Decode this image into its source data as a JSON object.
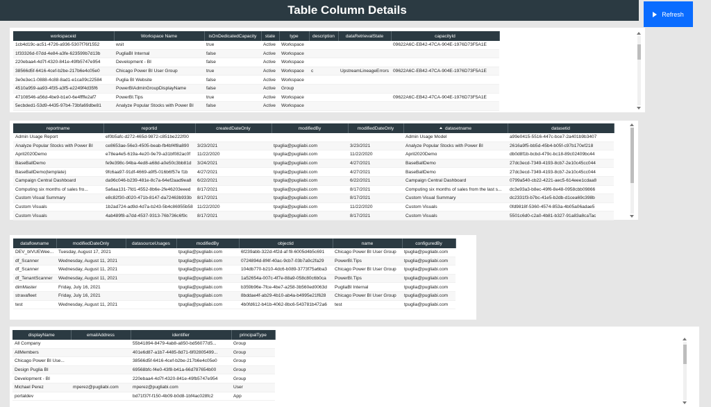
{
  "header": {
    "title": "Table Column Details",
    "refresh_label": "Refresh"
  },
  "workspaces": {
    "columns": [
      "workspaceid",
      "Workspace Name",
      "isOnDedicatedCapacity",
      "state",
      "type",
      "description",
      "dataRetrievalState",
      "capacityId"
    ],
    "rows": [
      [
        "1cb4d19c-ac51-4726-a936-5307f76f1552",
        "wsit",
        "true",
        "Active",
        "Workspace",
        "",
        "",
        "09622A6C-EB42-47CA-904E-1976D73F5A1E"
      ],
      [
        "1f33326d-07dd-4e84-a3fe-623599b7d13b",
        "PugliaBI Internal",
        "false",
        "Active",
        "Workspace",
        "",
        "",
        ""
      ],
      [
        "220ebaa4-4d7f-4320-841e-49fb5747e954",
        "Development - BI",
        "false",
        "Active",
        "Workspace",
        "",
        "",
        ""
      ],
      [
        "38566d5f-6416-4cef-b2be-217b6e4c05e0",
        "Chicago Power BI User Group",
        "true",
        "Active",
        "Workspace",
        "c",
        "UpstreamLineageErrors",
        "09622A6C-EB42-47CA-904E-1976D73F5A1E"
      ],
      [
        "3e0e3ec1-0888-4c88-8ad1-e1ca09c22584",
        "Puglia BI Website",
        "false",
        "Active",
        "Workspace",
        "",
        "",
        ""
      ],
      [
        "4510a959-aa93-4f35-a3f5-e2249f4d35f6",
        "PowerBIAdminGroupDisplayName",
        "false",
        "Active",
        "Group",
        "",
        "",
        ""
      ],
      [
        "47108546-a56d-4be9-b1e0-6e4ffffe2af7",
        "PowerBI.Tips",
        "true",
        "Active",
        "Workspace",
        "",
        "",
        "09622A6C-EB42-47CA-904E-1976D73F5A1E"
      ],
      [
        "5ecbded1-53d9-4435-97b4-73bfa69dbe81",
        "Analyze Popular Stocks with Power BI",
        "false",
        "Active",
        "Workspace",
        "",
        "",
        ""
      ]
    ]
  },
  "reports": {
    "columns": [
      "reportname",
      "reportid",
      "createdDateOnly",
      "modifiedBy",
      "modifiedDateOnly",
      "datasetname",
      "datasetid"
    ],
    "rows": [
      [
        "Admin Usage Report",
        "ef0b5afc-d272-465d-9872-c851be222f00",
        "",
        "",
        "",
        "Admin Usage Model",
        "a99e0415-5516-447c-bce7-2a401b9b3407"
      ],
      [
        "Analyze Popular Stocks with Power BI",
        "ce8653ae-56e3-4505-beab-fb4bf4f8a890",
        "3/23/2021",
        "tpuglia@pugliabi.com",
        "3/23/2021",
        "Analyze Popular Stocks with Power BI",
        "2616a9f5-bb5d-45b4-b05f-c97b170ef218"
      ],
      [
        "April2020Demo",
        "e78ea4e5-619a-4e20-9e79-a31bf082ac0f",
        "11/22/2020",
        "tpuglia@pugliabi.com",
        "11/22/2020",
        "April2020Demo",
        "db0d8f1b-bcbd-479c-bc18-89c02409bc44"
      ],
      [
        "BaseBallDemo",
        "fe9e398c-94ba-4ed8-a68d-a0e50c3bb81d",
        "3/24/2021",
        "tpuglia@pugliabi.com",
        "4/27/2021",
        "BaseBallDemo",
        "27dc3ecd-7349-4193-8cb7-2e10c45cc044"
      ],
      [
        "BaseBallDemo(template)",
        "9fc6aa97-91df-4669-a9f5-016b6f57e f1b",
        "4/27/2021",
        "tpuglia@pugliabi.com",
        "4/27/2021",
        "BaseBallDemo",
        "27dc3ecd-7349-4193-8cb7-2e10c45cc044"
      ],
      [
        "Campaign Central Dashboard",
        "da96c046-b239-481e-8c7a-64ef2aad9ea8",
        "6/22/2021",
        "tpuglia@pugliabi.com",
        "6/22/2021",
        "Campaign Central Dashboard",
        "0799a540-cb22-4221-aec5-614eee1cdaa8"
      ],
      [
        "Computing six months of sales fro...",
        "5a6aa131-7fd1-4552-8b6e-2fe46203eeed",
        "8/17/2021",
        "tpuglia@pugliabi.com",
        "8/17/2021",
        "Computing six months of sales from the last s...",
        "dc3e93a3-b8ec-49f6-8e48-0958cbb09866"
      ],
      [
        "Custom Visual Summary",
        "e8c82f30-d020-471b-8147-da72463b933b",
        "8/17/2021",
        "tpuglia@pugliabi.com",
        "8/17/2021",
        "Custom Visual Summary",
        "dc2331f3-b7bc-41e5-b2db-d1cea69c398b"
      ],
      [
        "Custom Visuals",
        "1b2ad724-ad9d-4d7a-b243-5b4c86955b58",
        "11/22/2020",
        "tpuglia@pugliabi.com",
        "11/22/2020",
        "Custom Visuals",
        "0fd9818f-5360-4574-853a-4b05a06adae5"
      ],
      [
        "Custom Visuals",
        "4ab489f8-a7dd-4537-9313-76b736c6f9c",
        "8/17/2021",
        "tpuglia@pugliabi.com",
        "8/17/2021",
        "Custom Visuals",
        "5501c6d0-c2a0-4b81-b327-91a83a8caTac"
      ]
    ]
  },
  "dataflows": {
    "columns": [
      "dataflowname",
      "modifiedDateOnly",
      "datasourceUsages",
      "modifiedBy",
      "objectid",
      "name",
      "configuredBy"
    ],
    "rows": [
      [
        "DEV_bIVUEWee...",
        "Tuesday, August 17, 2021",
        "",
        "tpuglia@pugliabi.com",
        "6f239abb-322d-4f2d-af f8-6005d4b5c691",
        "Chicago Power BI User Group",
        "tpuglia@pugliabi.com"
      ],
      [
        "df_Scanner",
        "Wednesday, August 11, 2021",
        "",
        "tpuglia@pugliabi.com",
        "0724894d-8f4f-40ac-9cb7-03b7a9c2fa29",
        "PowerBI.Tips",
        "tpuglia@pugliabi.com"
      ],
      [
        "df_Scanner",
        "Wednesday, August 11, 2021",
        "",
        "tpuglia@pugliabi.com",
        "104db770-b210-4dc6-b089-3773f75a6ba3",
        "Chicago Power BI User Group",
        "tpuglia@pugliabi.com"
      ],
      [
        "df_TenantScanner",
        "Wednesday, August 11, 2021",
        "",
        "tpuglia@pugliabi.com",
        "1a52654a-007c-4f7e-88a9-058c80c6b0ca",
        "PowerBI.Tips",
        "tpuglia@pugliabi.com"
      ],
      [
        "dimMaster",
        "Friday, July 16, 2021",
        "",
        "tpuglia@pugliabi.com",
        "b359b96e-7fce-4be7-a258-3b560ed0063d",
        "PugliaBI Internal",
        "tpuglia@pugliabi.com"
      ],
      [
        "stravafleet",
        "Friday, July 16, 2021",
        "",
        "tpuglia@pugliabi.com",
        "8bddae4f-ab29-4b10-ab4a-b4995e21f628",
        "Chicago Power BI User Group",
        "tpuglia@pugliabi.com"
      ],
      [
        "test",
        "Wednesday, August 11, 2021",
        "",
        "tpuglia@pugliabi.com",
        "4b0fd612-b41b-4062-8bc6-543781b472a6",
        "test",
        "tpuglia@pugliabi.com"
      ]
    ]
  },
  "principals": {
    "columns": [
      "displayName",
      "emailAddress",
      "identifier",
      "principalType"
    ],
    "rows": [
      [
        "All Company",
        "",
        "55b41894-8479-4ab8-a850-bd56077d5...",
        "Group"
      ],
      [
        "AllMembers",
        "",
        "401e6d87-a1b7-4485-8d71-6f02805499...",
        "Group"
      ],
      [
        "Chicago Power BI Use...",
        "",
        "38566d5f-6416-4cef-b2be-217b6e4c05e0",
        "Group"
      ],
      [
        "Design Puglia BI",
        "",
        "69568bfc-f4e0-43f8-b41a-66d787654b00",
        "Group"
      ],
      [
        "Development - BI",
        "",
        "220ebaa4-4d7f-4320-841e-49fb5747e954",
        "Group"
      ],
      [
        "Michael Perez",
        "mperez@pugliabi.com",
        "mperez@pugliabi.com",
        "User"
      ],
      [
        "portaldev",
        "",
        "bd71f37f-f150-4b09-b0d8-1bf4ac028fc2",
        "App"
      ]
    ]
  }
}
